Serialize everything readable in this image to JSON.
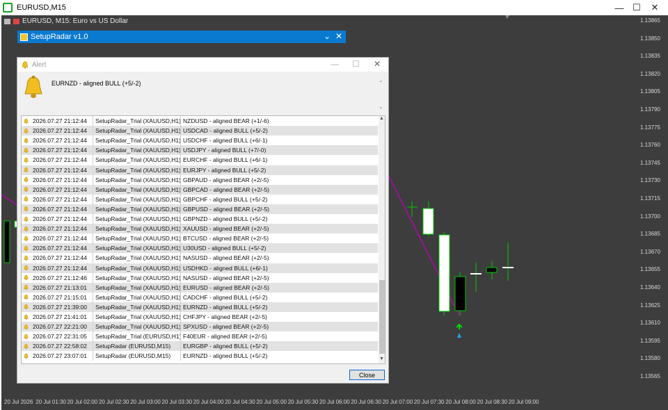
{
  "window": {
    "title": "EURUSD,M15",
    "minimize": "—",
    "maximize": "☐",
    "close": "✕"
  },
  "chart": {
    "header": "EURUSD, M15:  Euro vs US Dollar",
    "price_ticks": [
      "1.13865",
      "1.13850",
      "1.13835",
      "1.13820",
      "1.13805",
      "1.13790",
      "1.13775",
      "1.13760",
      "1.13745",
      "1.13730",
      "1.13715",
      "1.13700",
      "1.13685",
      "1.13670",
      "1.13655",
      "1.13640",
      "1.13625",
      "1.13610",
      "1.13595",
      "1.13580",
      "1.13565"
    ],
    "time_ticks": [
      "20 Jul 2026",
      "20 Jul 01:30",
      "20 Jul 02:00",
      "20 Jul 02:30",
      "20 Jul 03:00",
      "20 Jul 03:30",
      "20 Jul 04:00",
      "20 Jul 04:30",
      "20 Jul 05:00",
      "20 Jul 05:30",
      "20 Jul 06:00",
      "20 Jul 06:30",
      "20 Jul 07:00",
      "20 Jul 07:30",
      "20 Jul 08:00",
      "20 Jul 08:30",
      "20 Jul 09:00"
    ],
    "colors": {
      "background": "#3d3d3d",
      "bull": "#ffffff",
      "bear": "#000000",
      "wick": "#00c800",
      "trendline": "#c000c0"
    }
  },
  "setup_panel": {
    "title": "SetupRadar  v1.0",
    "collapse": "⌄",
    "close": "✕"
  },
  "alert": {
    "title": "Alert",
    "message": "EURNZD - aligned BULL (+5/-2)",
    "rows": [
      {
        "time": "2026.07.27 21:12:44",
        "source": "SetupRadar_Trial (XAUUSD,H1)",
        "text": "NZDUSD - aligned BEAR (+1/-6)"
      },
      {
        "time": "2026.07.27 21:12:44",
        "source": "SetupRadar_Trial (XAUUSD,H1)",
        "text": "USDCAD - aligned BULL (+5/-2)"
      },
      {
        "time": "2026.07.27 21:12:44",
        "source": "SetupRadar_Trial (XAUUSD,H1)",
        "text": "USDCHF - aligned BULL (+6/-1)"
      },
      {
        "time": "2026.07.27 21:12:44",
        "source": "SetupRadar_Trial (XAUUSD,H1)",
        "text": "USDJPY - aligned BULL (+7/-0)"
      },
      {
        "time": "2026.07.27 21:12:44",
        "source": "SetupRadar_Trial (XAUUSD,H1)",
        "text": "EURCHF - aligned BULL (+6/-1)"
      },
      {
        "time": "2026.07.27 21:12:44",
        "source": "SetupRadar_Trial (XAUUSD,H1)",
        "text": "EURJPY - aligned BULL (+5/-2)"
      },
      {
        "time": "2026.07.27 21:12:44",
        "source": "SetupRadar_Trial (XAUUSD,H1)",
        "text": "GBPAUD - aligned BEAR (+2/-5)"
      },
      {
        "time": "2026.07.27 21:12:44",
        "source": "SetupRadar_Trial (XAUUSD,H1)",
        "text": "GBPCAD - aligned BEAR (+2/-5)"
      },
      {
        "time": "2026.07.27 21:12:44",
        "source": "SetupRadar_Trial (XAUUSD,H1)",
        "text": "GBPCHF - aligned BULL (+5/-2)"
      },
      {
        "time": "2026.07.27 21:12:44",
        "source": "SetupRadar_Trial (XAUUSD,H1)",
        "text": "GBPUSD - aligned BEAR (+2/-5)"
      },
      {
        "time": "2026.07.27 21:12:44",
        "source": "SetupRadar_Trial (XAUUSD,H1)",
        "text": "GBPNZD - aligned BULL (+5/-2)"
      },
      {
        "time": "2026.07.27 21:12:44",
        "source": "SetupRadar_Trial (XAUUSD,H1)",
        "text": "XAUUSD - aligned BEAR (+2/-5)"
      },
      {
        "time": "2026.07.27 21:12:44",
        "source": "SetupRadar_Trial (XAUUSD,H1)",
        "text": "BTCUSD - aligned BEAR (+2/-5)"
      },
      {
        "time": "2026.07.27 21:12:44",
        "source": "SetupRadar_Trial (XAUUSD,H1)",
        "text": "U30USD - aligned BULL (+5/-2)"
      },
      {
        "time": "2026.07.27 21:12:44",
        "source": "SetupRadar_Trial (XAUUSD,H1)",
        "text": "NASUSD - aligned BEAR (+2/-5)"
      },
      {
        "time": "2026.07.27 21:12:44",
        "source": "SetupRadar_Trial (XAUUSD,H1)",
        "text": "USDHKD - aligned BULL (+6/-1)"
      },
      {
        "time": "2026.07.27 21:12:46",
        "source": "SetupRadar_Trial (XAUUSD,H1)",
        "text": "NASUSD - aligned BEAR (+2/-5)"
      },
      {
        "time": "2026.07.27 21:13:01",
        "source": "SetupRadar_Trial (XAUUSD,H1)",
        "text": "EURUSD - aligned BEAR (+2/-5)"
      },
      {
        "time": "2026.07.27 21:15:01",
        "source": "SetupRadar_Trial (XAUUSD,H1)",
        "text": "CADCHF - aligned BULL (+5/-2)"
      },
      {
        "time": "2026.07.27 21:39:00",
        "source": "SetupRadar_Trial (XAUUSD,H1)",
        "text": "EURNZD - aligned BULL (+5/-2)"
      },
      {
        "time": "2026.07.27 21:41:01",
        "source": "SetupRadar_Trial (XAUUSD,H1)",
        "text": "CHFJPY - aligned BEAR (+2/-5)"
      },
      {
        "time": "2026.07.27 22:21:00",
        "source": "SetupRadar_Trial (XAUUSD,H1)",
        "text": "SPXUSD - aligned BEAR (+2/-5)"
      },
      {
        "time": "2026.07.27 22:31:05",
        "source": "SetupRadar_Trial (EURUSD,H1)",
        "text": "F40EUR - aligned BEAR (+2/-5)"
      },
      {
        "time": "2026.07.27 22:58:02",
        "source": "SetupRadar (EURUSD,M15)",
        "text": "EURGBP - aligned BULL (+5/-2)"
      },
      {
        "time": "2026.07.27 23:07:01",
        "source": "SetupRadar (EURUSD,M15)",
        "text": "EURNZD - aligned BULL (+5/-2)"
      }
    ],
    "close_label": "Close"
  }
}
